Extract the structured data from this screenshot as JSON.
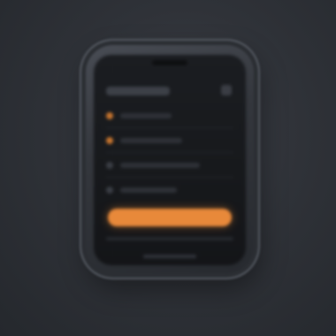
{
  "scene": {
    "description_label": "",
    "accent_color": "#e8893a",
    "background_color": "#2f3238",
    "screen_color": "#17191c"
  },
  "phone": {
    "list_rows": [
      {
        "dot_color": "#c8752e",
        "line_width_fraction": 0.45
      },
      {
        "dot_color": "#c8752e",
        "line_width_fraction": 0.55
      },
      {
        "dot_color": "#3a3d44",
        "line_width_fraction": 0.7
      },
      {
        "dot_color": "#3a3d44",
        "line_width_fraction": 0.5
      }
    ],
    "cta_label": ""
  }
}
